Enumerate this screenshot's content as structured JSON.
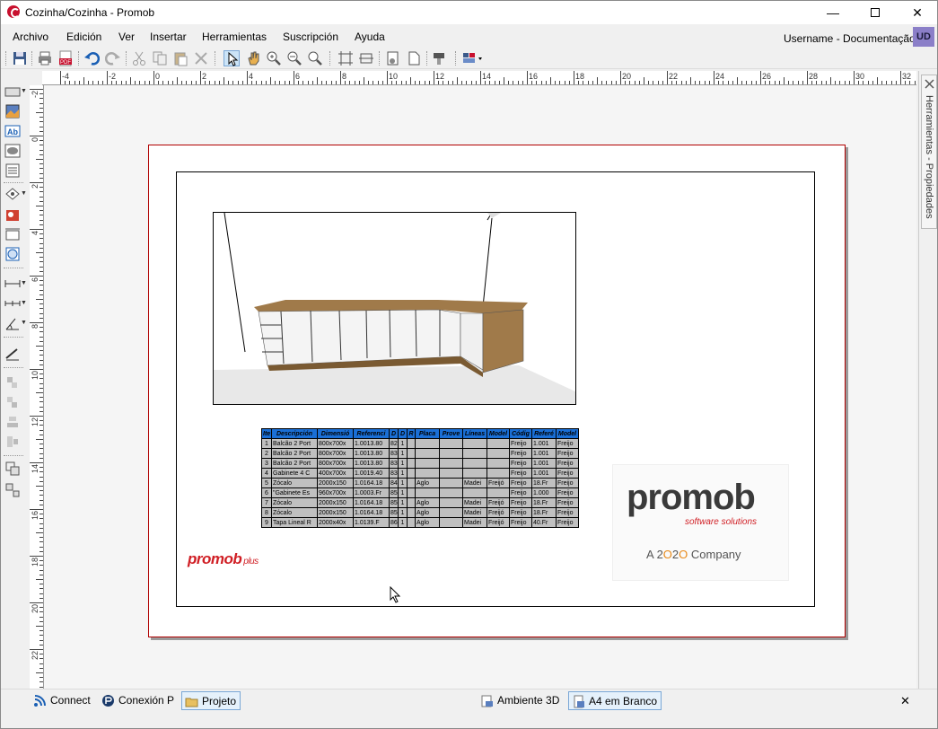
{
  "window": {
    "title": "Cozinha/Cozinha - Promob"
  },
  "menu": [
    "Archivo",
    "Edición",
    "Ver",
    "Insertar",
    "Herramientas",
    "Suscripción",
    "Ayuda"
  ],
  "user": {
    "name": "Username - Documentação",
    "initials": "UD"
  },
  "ruler": {
    "h": [
      "-4",
      "-2",
      "0",
      "2",
      "4",
      "6",
      "8",
      "10",
      "12",
      "14",
      "16",
      "18",
      "20",
      "22",
      "24",
      "26",
      "28",
      "30",
      "32"
    ],
    "v": [
      "-2",
      "0",
      "2",
      "4",
      "6",
      "8",
      "10",
      "12",
      "14",
      "16",
      "18",
      "20",
      "22"
    ]
  },
  "table": {
    "headers": [
      "Ite",
      "Descripción",
      "Dimensió",
      "Referenci",
      "D",
      "D",
      "R",
      "Placa",
      "Prove",
      "Líneas",
      "Model",
      "Códig",
      "Referé",
      "Model"
    ],
    "rows": [
      [
        "1",
        "Balcão 2 Port",
        "800x700x",
        "1.0013.80",
        "829",
        "1",
        "",
        "",
        "",
        "",
        "Freijo",
        "1.001",
        "Freijo"
      ],
      [
        "2",
        "Balcão 2 Port",
        "800x700x",
        "1.0013.80",
        "830",
        "1",
        "",
        "",
        "",
        "",
        "Freijo",
        "1.001",
        "Freijo"
      ],
      [
        "3",
        "Balcão 2 Port",
        "800x700x",
        "1.0013.80",
        "832",
        "1",
        "",
        "",
        "",
        "",
        "Freijo",
        "1.001",
        "Freijo"
      ],
      [
        "4",
        "Gabinete 4 C",
        "400x700x",
        "1.0019.40",
        "839",
        "1",
        "",
        "",
        "",
        "",
        "Freijo",
        "1.001",
        "Freijo"
      ],
      [
        "5",
        "Zócalo",
        "2000x150",
        "1.0164.18",
        "840",
        "1",
        "Aglo",
        "",
        "Madei",
        "Freijó",
        "Freijo",
        "18.Fr",
        "Freijo"
      ],
      [
        "6",
        "\"Gabinete Es",
        "960x700x",
        "1.0003.Fr",
        "851",
        "1",
        "",
        "",
        "",
        "",
        "Freijo",
        "1.000",
        "Freijo"
      ],
      [
        "7",
        "Zócalo",
        "2000x150",
        "1.0164.18",
        "852",
        "1",
        "Aglo",
        "",
        "Madei",
        "Freijó",
        "Freijo",
        "18.Fr",
        "Freijo"
      ],
      [
        "8",
        "Zócalo",
        "2000x150",
        "1.0164.18",
        "854",
        "1",
        "Aglo",
        "",
        "Madei",
        "Freijó",
        "Freijo",
        "18.Fr",
        "Freijo"
      ],
      [
        "9",
        "Tapa Lineal R",
        "2000x40x",
        "1.0139.F",
        "860",
        "1",
        "Aglo",
        "",
        "Madei",
        "Freijó",
        "Freijo",
        "40.Fr",
        "Freijo"
      ]
    ]
  },
  "logos": {
    "small": {
      "word": "promob",
      "suffix": "plus"
    },
    "big": {
      "word": "promob",
      "sub": "software solutions",
      "company_a": "A 2",
      "company_o1": "O",
      "company_2": "2",
      "company_o2": "O",
      "company_b": " Company"
    }
  },
  "right_panel": {
    "tab_label": "Herramientas - Propiedades"
  },
  "bottom_tabs": {
    "left": [
      {
        "label": "Connect",
        "icon": "rss-icon"
      },
      {
        "label": "Conexión P",
        "icon": "promob-connect-icon"
      },
      {
        "label": "Projeto",
        "icon": "folder-icon",
        "active": true
      }
    ],
    "right": [
      {
        "label": "Ambiente 3D",
        "icon": "environment-3d-icon"
      },
      {
        "label": "A4 em Branco",
        "icon": "page-icon",
        "active": true
      }
    ],
    "close": "✕"
  },
  "colors": {
    "accent_red": "#d01e24",
    "table_header": "#1a6fd6",
    "table_cell": "#c0c0c0",
    "wood": "#a07a4a"
  }
}
